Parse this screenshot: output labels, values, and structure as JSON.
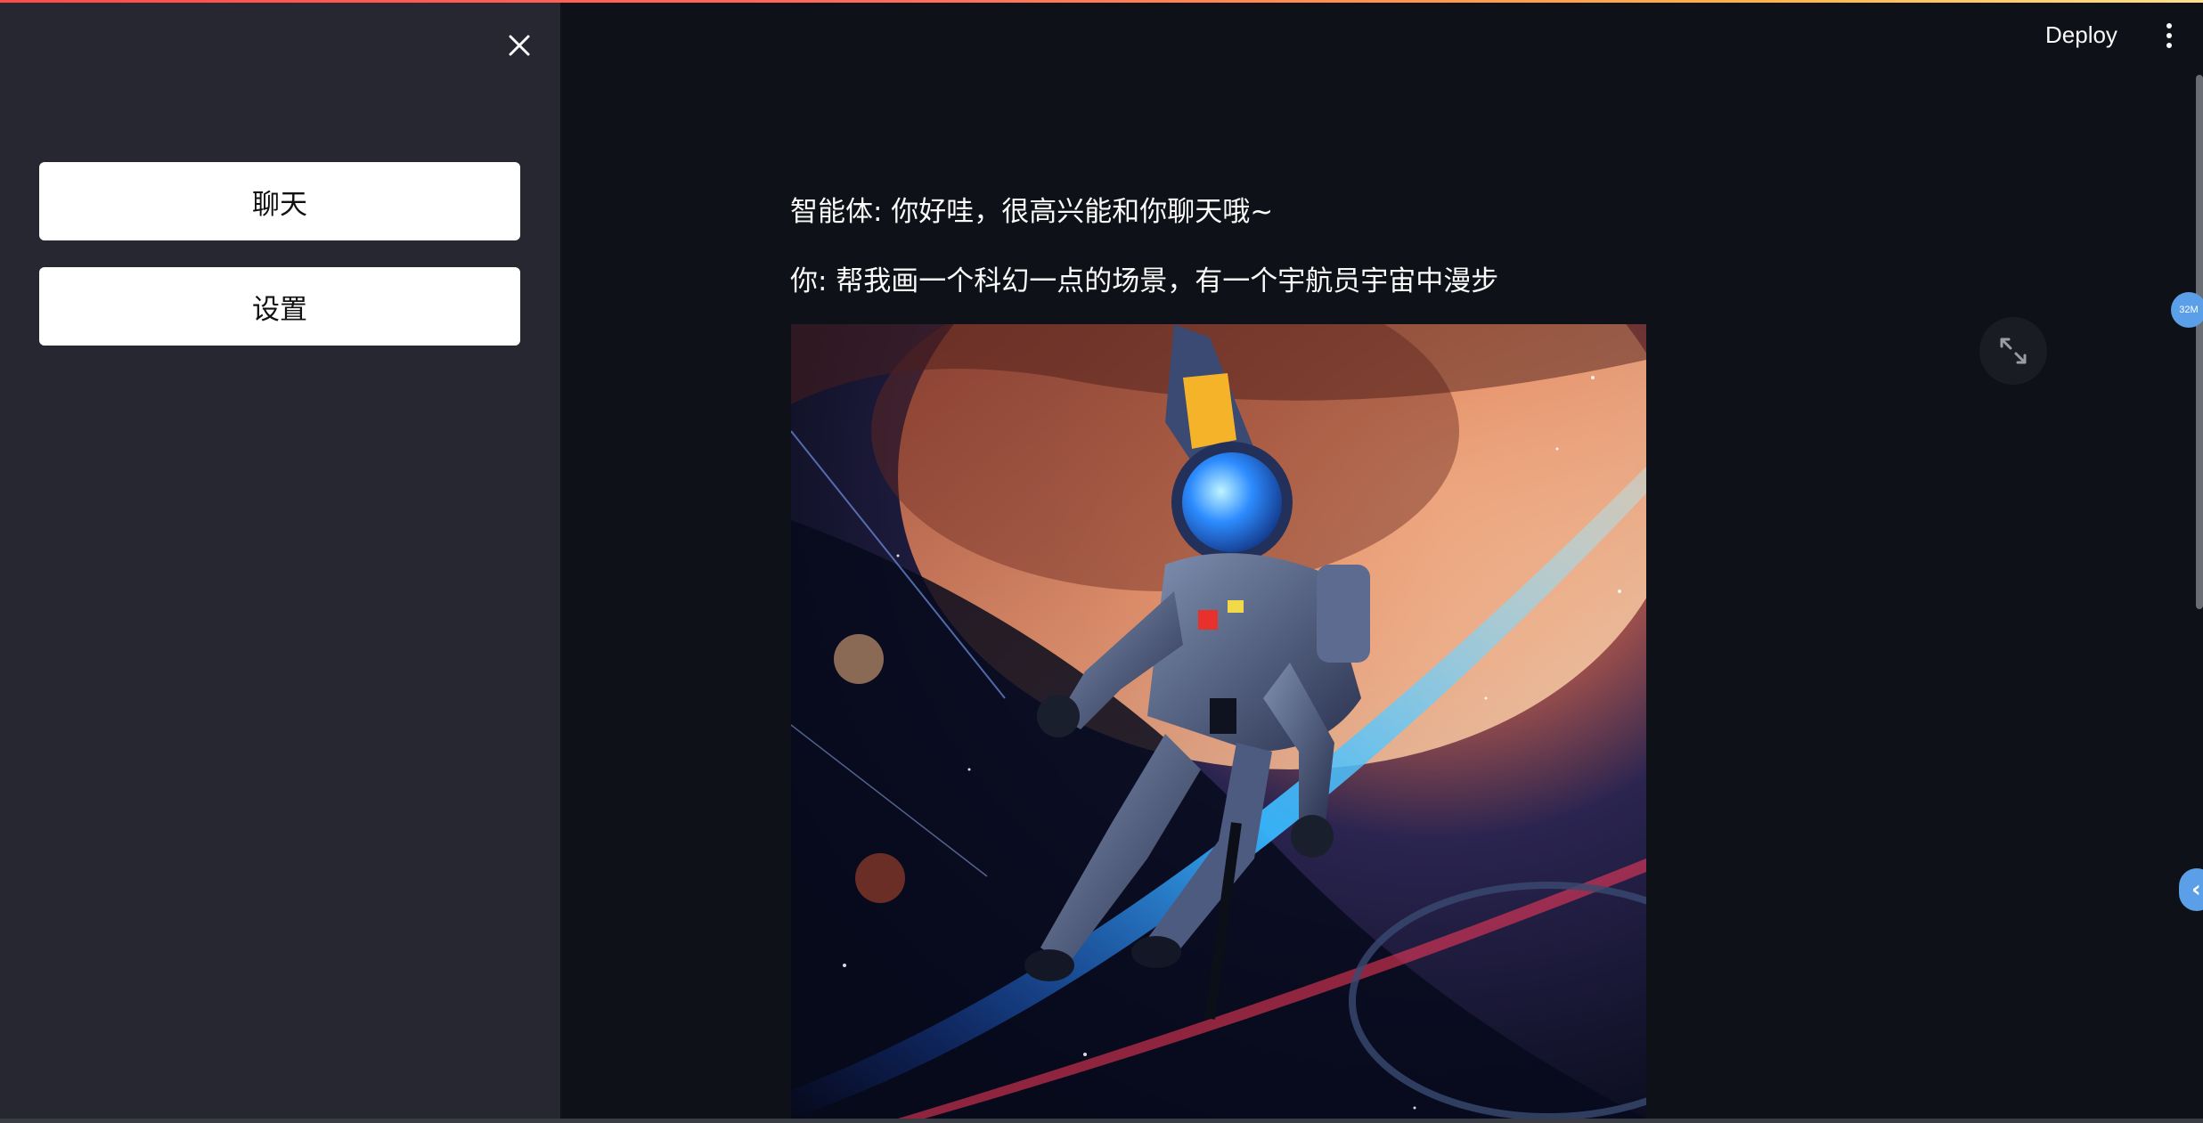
{
  "sidebar": {
    "close_icon": "close-icon",
    "buttons": [
      {
        "label": "聊天"
      },
      {
        "label": "设置"
      }
    ]
  },
  "header": {
    "deploy_label": "Deploy",
    "menu_icon": "vertical-dots-icon"
  },
  "chat": {
    "messages": [
      {
        "text": "智能体: 你好哇，很高兴能和你聊天哦~"
      },
      {
        "text": "你: 帮我画一个科幻一点的场景，有一个宇航员宇宙中漫步"
      }
    ],
    "image": {
      "alt": "astronaut floating in space illustration"
    },
    "fullscreen_icon": "fullscreen-icon"
  },
  "overlay": {
    "memory_badge": "32M",
    "side_toggle_icon": "chevron-left-icon"
  },
  "colors": {
    "app_bg": "#0e1117",
    "sidebar_bg": "#262730",
    "text": "#fafafa",
    "accent": "#5a9fe8"
  }
}
